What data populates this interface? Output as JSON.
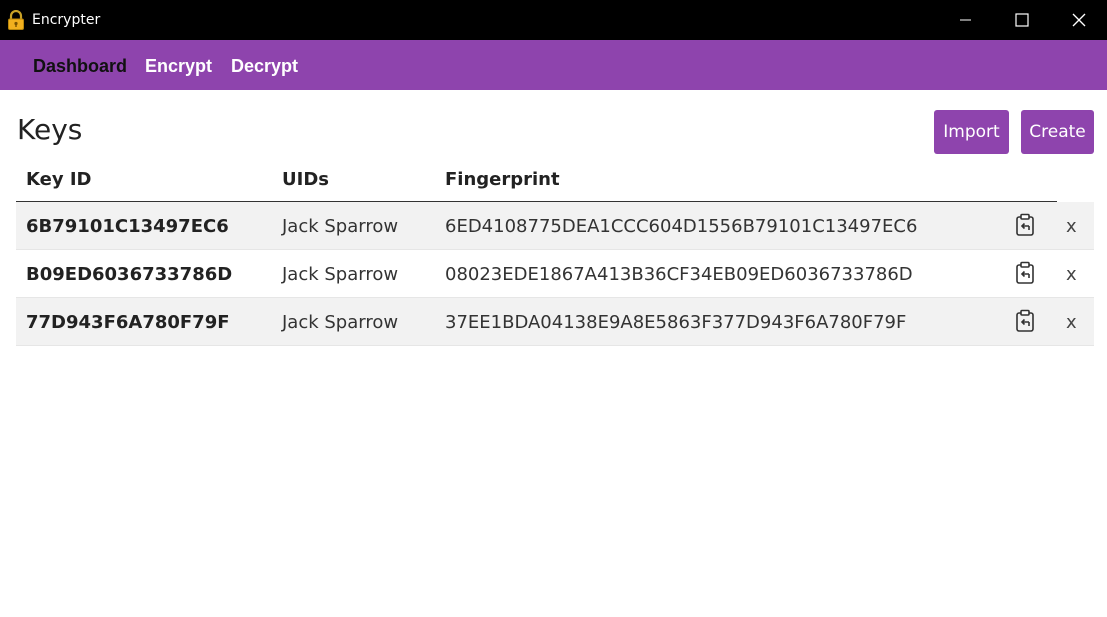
{
  "window": {
    "title": "Encrypter",
    "icon": "lock-icon",
    "controls": [
      "minimize-icon",
      "maximize-icon",
      "close-icon"
    ]
  },
  "nav": {
    "items": [
      {
        "label": "Dashboard",
        "active": true
      },
      {
        "label": "Encrypt",
        "active": false
      },
      {
        "label": "Decrypt",
        "active": false
      }
    ]
  },
  "page": {
    "title": "Keys",
    "import_label": "Import",
    "create_label": "Create"
  },
  "table": {
    "headers": [
      "Key ID",
      "UIDs",
      "Fingerprint"
    ],
    "rows": [
      {
        "key_id": "6B79101C13497EC6",
        "uid": "Jack Sparrow",
        "fingerprint": "6ED4108775DEA1CCC604D1556B79101C13497EC6",
        "copy_icon": "clipboard-icon",
        "delete_label": "x"
      },
      {
        "key_id": "B09ED6036733786D",
        "uid": "Jack Sparrow",
        "fingerprint": "08023EDE1867A413B36CF34EB09ED6036733786D",
        "copy_icon": "clipboard-icon",
        "delete_label": "x"
      },
      {
        "key_id": "77D943F6A780F79F",
        "uid": "Jack Sparrow",
        "fingerprint": "37EE1BDA04138E9A8E5863F377D943F6A780F79F",
        "copy_icon": "clipboard-icon",
        "delete_label": "x"
      }
    ]
  },
  "colors": {
    "accent": "#8e44ad",
    "titlebar": "#000000",
    "row_stripe": "#f2f2f2"
  }
}
